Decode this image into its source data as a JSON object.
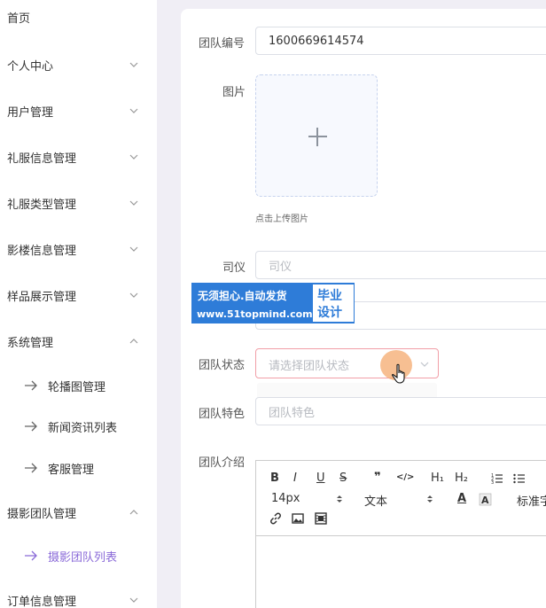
{
  "sidebar": {
    "items": [
      {
        "label": "首页"
      },
      {
        "label": "个人中心"
      },
      {
        "label": "用户管理"
      },
      {
        "label": "礼服信息管理"
      },
      {
        "label": "礼服类型管理"
      },
      {
        "label": "影楼信息管理"
      },
      {
        "label": "样品展示管理"
      },
      {
        "label": "系统管理"
      },
      {
        "label": "摄影团队管理"
      },
      {
        "label": "订单信息管理"
      }
    ],
    "system_sub": [
      {
        "label": "轮播图管理"
      },
      {
        "label": "新闻资讯列表"
      },
      {
        "label": "客服管理"
      }
    ],
    "team_sub": [
      {
        "label": "摄影团队列表"
      }
    ],
    "active_color": "#8a6ad8"
  },
  "form": {
    "team_no_label": "团队编号",
    "team_no_value": "1600669614574",
    "image_label": "图片",
    "upload_hint": "点击上传图片",
    "host_label": "司仪",
    "host_placeholder": "司仪",
    "status_label": "团队状态",
    "status_placeholder": "请选择团队状态",
    "feature_label": "团队特色",
    "feature_placeholder": "团队特色",
    "intro_label": "团队介绍"
  },
  "editor": {
    "bold": "B",
    "italic": "I",
    "underline": "U",
    "strike": "S",
    "quote": "❞",
    "code": "</>",
    "h1": "H₁",
    "h2": "H₂",
    "font_size": "14px",
    "text_type": "文本",
    "font_color": "A",
    "font_family": "标准字"
  },
  "watermark": {
    "line1": "无须担心.自动发货",
    "line2": "www.51topmind.com",
    "box1": "毕业",
    "box2": "设计"
  }
}
